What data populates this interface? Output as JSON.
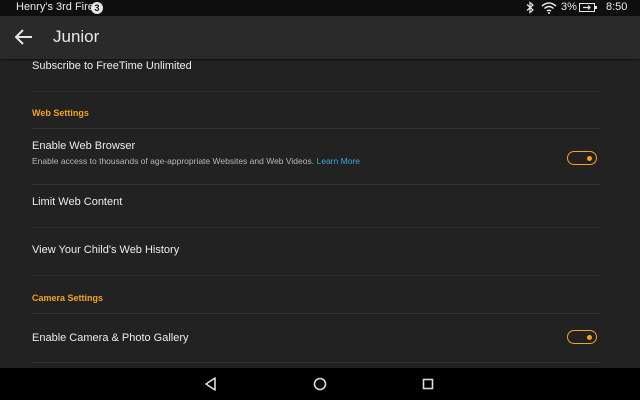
{
  "status_bar": {
    "device_name": "Henry's 3rd Fire",
    "notification_count": "3",
    "battery_percent": "3%",
    "time": "8:50"
  },
  "app_bar": {
    "title": "Junior"
  },
  "settings": {
    "subscribe_label": "Subscribe to FreeTime Unlimited",
    "web_section_title": "Web Settings",
    "enable_browser": {
      "label": "Enable Web Browser",
      "description": "Enable access to thousands of age-appropriate Websites and Web Videos.",
      "link": "Learn More",
      "enabled": true
    },
    "limit_web_content_label": "Limit Web Content",
    "web_history_label": "View Your Child's Web History",
    "camera_section_title": "Camera Settings",
    "enable_camera": {
      "label": "Enable Camera & Photo Gallery",
      "enabled": true
    }
  },
  "colors": {
    "accent": "#f4a31b",
    "link": "#37a9e0",
    "background": "#222222"
  },
  "icons": [
    "badge-3-icon",
    "bluetooth-icon",
    "wifi-icon",
    "battery-charging-icon",
    "back-arrow-icon",
    "back-triangle-icon",
    "home-circle-icon",
    "recents-square-icon"
  ]
}
